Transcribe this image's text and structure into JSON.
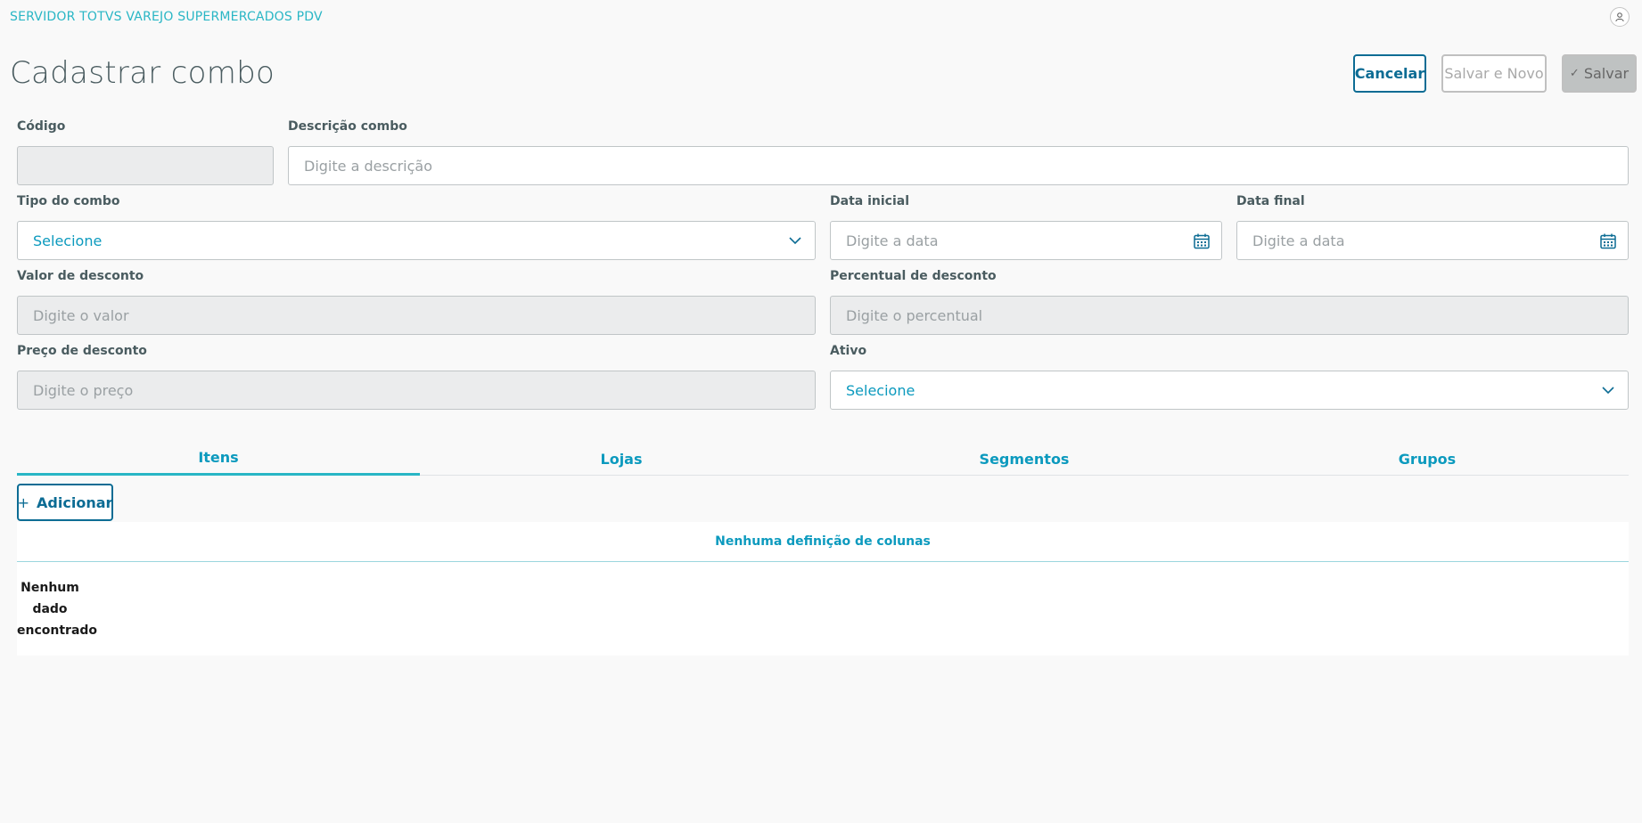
{
  "app": {
    "title": "SERVIDOR TOTVS VAREJO SUPERMERCADOS PDV"
  },
  "page": {
    "title": "Cadastrar combo"
  },
  "actions": {
    "cancel": "Cancelar",
    "save_new": "Salvar e Novo",
    "save": "Salvar"
  },
  "form": {
    "codigo": {
      "label": "Código",
      "value": ""
    },
    "descricao": {
      "label": "Descrição combo",
      "placeholder": "Digite a descrição"
    },
    "tipo": {
      "label": "Tipo do combo",
      "value": "Selecione"
    },
    "data_inicial": {
      "label": "Data inicial",
      "placeholder": "Digite a data"
    },
    "data_final": {
      "label": "Data final",
      "placeholder": "Digite a data"
    },
    "valor_desconto": {
      "label": "Valor de desconto",
      "placeholder": "Digite o valor"
    },
    "percentual_desconto": {
      "label": "Percentual de desconto",
      "placeholder": "Digite o percentual"
    },
    "preco_desconto": {
      "label": "Preço de desconto",
      "placeholder": "Digite o preço"
    },
    "ativo": {
      "label": "Ativo",
      "value": "Selecione"
    }
  },
  "tabs": [
    {
      "label": "Itens",
      "active": true
    },
    {
      "label": "Lojas",
      "active": false
    },
    {
      "label": "Segmentos",
      "active": false
    },
    {
      "label": "Grupos",
      "active": false
    }
  ],
  "table": {
    "add_label": "Adicionar",
    "no_columns": "Nenhuma definição de colunas",
    "empty_lines": [
      "Nenhum",
      "dado",
      "encontrado"
    ]
  },
  "colors": {
    "accent": "#29b6c5",
    "primary": "#0c6c94",
    "link": "#0c9abe",
    "text": "#4a5c60"
  },
  "icons": {
    "user": "user-icon",
    "chevron": "chevron-down-icon",
    "calendar": "calendar-icon",
    "check": "check-icon",
    "plus": "plus-icon"
  }
}
